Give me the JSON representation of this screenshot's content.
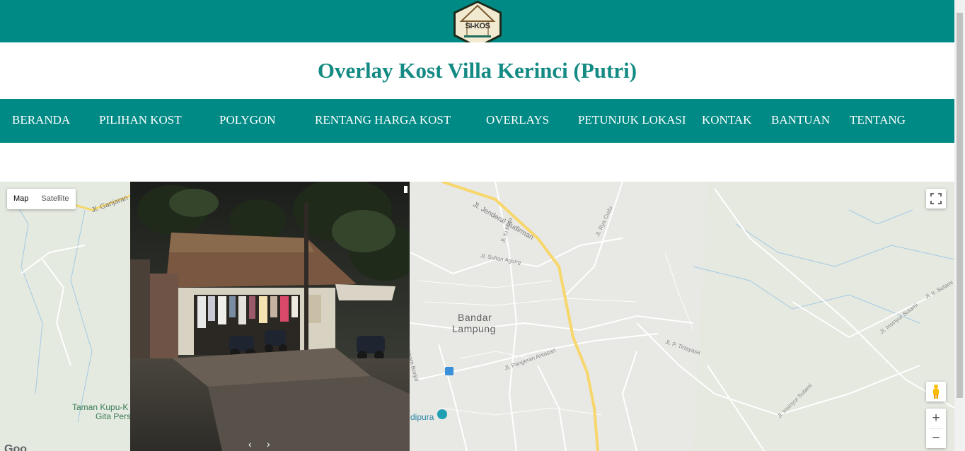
{
  "header": {
    "logo_text": "SI-KOS",
    "title": "Overlay Kost Villa Kerinci (Putri)"
  },
  "nav": {
    "items": [
      "BERANDA",
      "PILIHAN KOST",
      "POLYGON",
      "RENTANG HARGA KOST",
      "OVERLAYS",
      "PETUNJUK LOKASI",
      "KONTAK",
      "BANTUAN",
      "TENTANG"
    ]
  },
  "map": {
    "type_buttons": {
      "map": "Map",
      "satellite": "Satellite"
    },
    "city_label_line1": "Bandar",
    "city_label_line2": "Lampung",
    "park_label_line1": "Taman Kupu-K",
    "park_label_line2": "Gita Pers",
    "poi_label": "dipura",
    "roads": {
      "sudirman": "Jl. Jenderal Sudirman",
      "ganjaran": "Jl. Ganjaran",
      "kimas": "Jl. Ki Maja",
      "ryacudu": "Jl. Rya Cudu",
      "sultan": "Jl. Sultan Agung",
      "pangeran": "Jl. Pangeran Antasari",
      "imam": "Imam Bonjol",
      "p_tirtayasa": "Jl. P. Tirtayasa",
      "insinyur1": "Jl. Insinyur Sutami",
      "insinyur2": "Jl. Ir. Sutami",
      "insinyur3": "Jl. Insinyur Sutami"
    },
    "zoom_in": "+",
    "zoom_out": "−",
    "google_partial": "Goo"
  },
  "street_view": {
    "prev": "‹",
    "next": "›"
  },
  "colors": {
    "teal": "#008a85",
    "title_teal": "#138a83"
  }
}
